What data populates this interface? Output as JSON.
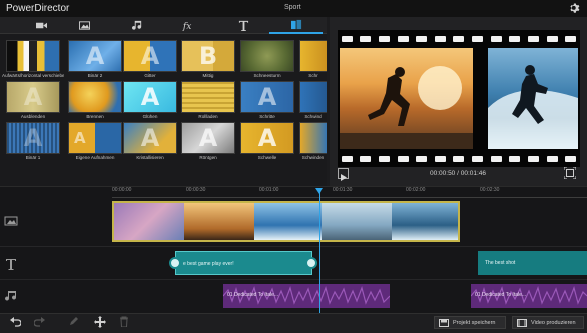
{
  "app": {
    "title": "PowerDirector",
    "project_name": "Sport"
  },
  "tabs": [
    {
      "icon": "video-clip-icon",
      "active": false
    },
    {
      "icon": "image-icon",
      "active": false
    },
    {
      "icon": "music-note-icon",
      "active": false
    },
    {
      "icon": "fx-icon",
      "active": false
    },
    {
      "icon": "text-title-icon",
      "active": false
    },
    {
      "icon": "transition-icon",
      "active": true
    }
  ],
  "transitions": [
    {
      "label": "Aufwärts/horizontal verschieben"
    },
    {
      "label": "Binär 2"
    },
    {
      "label": "Gitter"
    },
    {
      "label": "Mittig"
    },
    {
      "label": "Schneesturm"
    },
    {
      "label": "Schr"
    },
    {
      "label": "Ausblenden"
    },
    {
      "label": "Brennen"
    },
    {
      "label": "Glühen"
    },
    {
      "label": "Rollladen"
    },
    {
      "label": "Schritte"
    },
    {
      "label": "Schwind"
    },
    {
      "label": "Binär 1"
    },
    {
      "label": "Eigene Aufnahmen"
    },
    {
      "label": "Kristallisieren"
    },
    {
      "label": "Röntgen"
    },
    {
      "label": "Schwelle"
    },
    {
      "label": "Schwinden"
    }
  ],
  "preview": {
    "timecode": "00:00:50 / 00:01:46"
  },
  "timeline": {
    "ruler_ticks": [
      "00:00:00",
      "00:00:30",
      "00:01:00",
      "00:01:30",
      "00:02:00",
      "00:02:30"
    ],
    "title_clips": [
      "e best game play ever!",
      "The best shot"
    ],
    "audio_clips": [
      "01 Dedicated To Itale...",
      "01 Dedicated To Itale..."
    ]
  },
  "bottom_bar": {
    "save_label": "Projekt speichern",
    "produce_label": "Video produzieren"
  },
  "colors": {
    "accent": "#2fa4e7",
    "title_clip": "#1b8a8e",
    "audio_clip": "#5e2a7a",
    "video_border": "#c5b54a"
  }
}
